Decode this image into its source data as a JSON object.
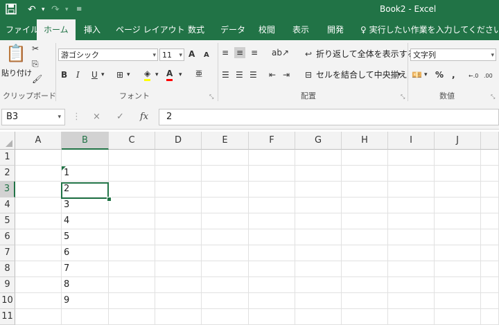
{
  "colors": {
    "accent": "#217346",
    "ribbon_bg": "#f3f3f3",
    "header_selected_bg": "#d2d2d2"
  },
  "window": {
    "title": "Book2  -  Excel"
  },
  "quick_access": {
    "save_icon": "save-icon",
    "undo_icon": "undo-icon",
    "redo_icon": "redo-icon",
    "customize_icon": "customize-icon"
  },
  "ribbon_tabs": [
    "ファイル",
    "ホーム",
    "挿入",
    "ページ レイアウト",
    "数式",
    "データ",
    "校閲",
    "表示",
    "開発"
  ],
  "active_tab": "ホーム",
  "tell_me": "実行したい作業を入力してください",
  "clipboard": {
    "paste_label": "貼り付け",
    "group_label": "クリップボード"
  },
  "font": {
    "family": "游ゴシック",
    "size": "11",
    "grow": "A",
    "shrink": "A",
    "bold": "B",
    "italic": "I",
    "underline": "U",
    "font_color_glyph": "A",
    "phonetic_glyph": "亜",
    "group_label": "フォント"
  },
  "alignment": {
    "wrap_text": "折り返して全体を表示する",
    "merge_center": "セルを結合して中央揃え",
    "group_label": "配置"
  },
  "number": {
    "format": "文字列",
    "percent": "%",
    "comma": ",",
    "increase_decimal": "+.0 .00",
    "decrease_decimal": ".00 →.0",
    "group_label": "数値"
  },
  "formula_bar": {
    "name_box": "B3",
    "cancel": "×",
    "enter": "✓",
    "fx": "fx",
    "content": "2"
  },
  "sheet": {
    "columns": [
      "A",
      "B",
      "C",
      "D",
      "E",
      "F",
      "G",
      "H",
      "I",
      "J"
    ],
    "selected_column": "B",
    "rows": [
      "1",
      "2",
      "3",
      "4",
      "5",
      "6",
      "7",
      "8",
      "9",
      "10",
      "11"
    ],
    "selected_row": "3",
    "b_values": [
      "",
      "1",
      "2",
      "3",
      "4",
      "5",
      "6",
      "7",
      "8",
      "9",
      ""
    ]
  }
}
